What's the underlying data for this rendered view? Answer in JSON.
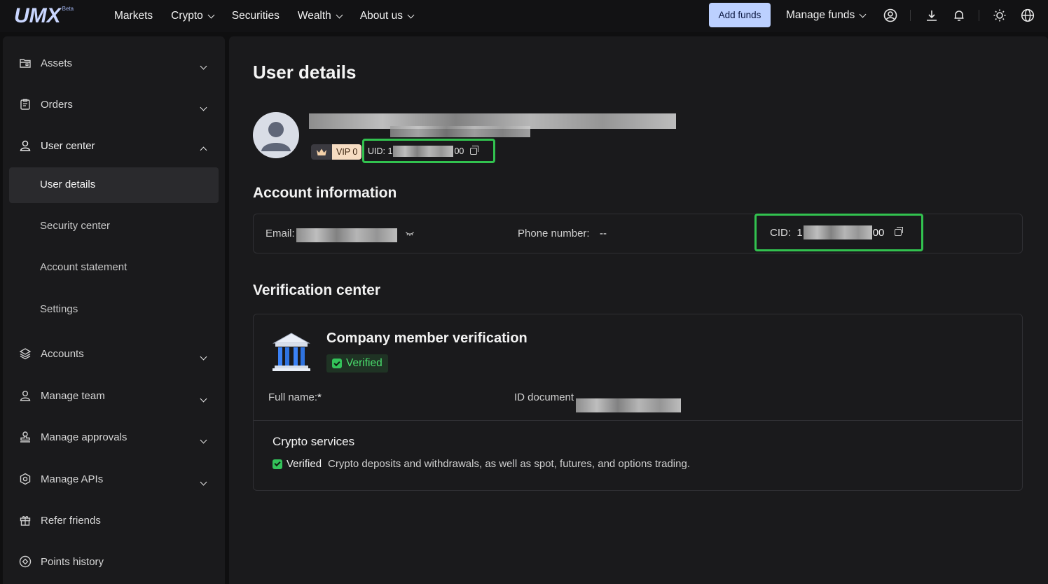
{
  "header": {
    "logo": "UMX",
    "logo_badge": "Beta",
    "nav": [
      {
        "label": "Markets",
        "dropdown": false
      },
      {
        "label": "Crypto",
        "dropdown": true
      },
      {
        "label": "Securities",
        "dropdown": false
      },
      {
        "label": "Wealth",
        "dropdown": true
      },
      {
        "label": "About us",
        "dropdown": true
      }
    ],
    "add_funds": "Add funds",
    "manage_funds": "Manage funds",
    "icons": [
      "user-circle-icon",
      "download-icon",
      "bell-icon",
      "sun-icon",
      "globe-icon"
    ]
  },
  "sidebar": {
    "items": [
      {
        "label": "Assets",
        "icon": "folder-icon",
        "chevron": "down"
      },
      {
        "label": "Orders",
        "icon": "clipboard-icon",
        "chevron": "down"
      },
      {
        "label": "User center",
        "icon": "user-icon",
        "chevron": "up"
      },
      {
        "label": "Accounts",
        "icon": "layers-icon",
        "chevron": "down"
      },
      {
        "label": "Manage team",
        "icon": "team-icon",
        "chevron": "down"
      },
      {
        "label": "Manage approvals",
        "icon": "stamp-icon",
        "chevron": "down"
      },
      {
        "label": "Manage APIs",
        "icon": "hexagon-icon",
        "chevron": "down"
      },
      {
        "label": "Refer friends",
        "icon": "gift-icon",
        "chevron": null
      },
      {
        "label": "Points history",
        "icon": "points-icon",
        "chevron": null
      }
    ],
    "user_center_sub": [
      "User details",
      "Security center",
      "Account statement",
      "Settings"
    ]
  },
  "main": {
    "title": "User details",
    "vip": "VIP 0",
    "uid_prefix": "UID: 1",
    "uid_suffix": "00",
    "account_info_title": "Account information",
    "email_label": "Email:",
    "phone_label": "Phone number:",
    "phone_value": "--",
    "cid_prefix": "CID:  1",
    "cid_suffix": "00",
    "verification_title": "Verification center",
    "company_title": "Company member verification",
    "verified": "Verified",
    "full_name_label": "Full name:",
    "full_name_value": "*",
    "id_document_label": "ID document",
    "crypto_title": "Crypto services",
    "crypto_verified": "Verified",
    "crypto_desc": "Crypto deposits and withdrawals, as well as spot, futures, and options trading."
  },
  "colors": {
    "accent": "#bcd0ff",
    "highlight_box": "#32c24f",
    "verified_green": "#4ade6d"
  }
}
